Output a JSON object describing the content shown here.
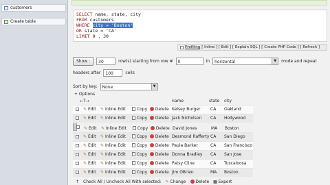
{
  "sidebar": {
    "items": [
      {
        "label": "customers",
        "icon": "table-icon"
      },
      {
        "label": "Create table",
        "icon": "add-table-icon"
      }
    ]
  },
  "sql": {
    "select_kw": "SELECT",
    "select_cols": " name, state, city",
    "from_kw": "FROM",
    "from_table": " customers",
    "where_kw": "WHERE",
    "where_sel": "city = 'Boston'",
    "or_kw": "OR",
    "or_rest": " state = 'CA'",
    "limit_kw": "LIMIT",
    "limit_rest": " 0 , 30"
  },
  "sqlbar": {
    "profiling": "Profiling",
    "links": "[ Inline ] [ Edit ] [ Explain SQL ] [ Create PHP Code ] [ Refresh ]"
  },
  "nav": {
    "show_label": "Show :",
    "rows_value": "30",
    "rows_text": "row(s) starting from row #",
    "start_value": "0",
    "in_text": "in",
    "mode_value": "horizontal",
    "mode_text": "mode and repeat",
    "headers_text": "headers after",
    "headers_value": "100",
    "cells_text": "cells"
  },
  "sort": {
    "label": "Sort by key:",
    "value": "None"
  },
  "options_label": "+ Options",
  "table": {
    "headers": {
      "arrows": "←T→",
      "name": "name",
      "state": "state",
      "city": "city"
    },
    "actions": {
      "edit": "Edit",
      "inline": "Inline Edit",
      "copy": "Copy",
      "delete": "Delete"
    },
    "rows": [
      {
        "name": "Kelsey Burger",
        "state": "CA",
        "city": "Oakland"
      },
      {
        "name": "Jack Nicholson",
        "state": "CA",
        "city": "Hollywood"
      },
      {
        "name": "David Jones",
        "state": "MA",
        "city": "Boston"
      },
      {
        "name": "Desmond Rafferty",
        "state": "CA",
        "city": "San Diego"
      },
      {
        "name": "Paula Barker",
        "state": "CA",
        "city": "San Francisco"
      },
      {
        "name": "Donna Bradley",
        "state": "CA",
        "city": "San Jose"
      },
      {
        "name": "Patsy Cline",
        "state": "CA",
        "city": "Tuscaloosa"
      },
      {
        "name": "Jim OBrien",
        "state": "MA",
        "city": "Boston"
      }
    ]
  },
  "bottom": {
    "check_all": "Check All / Uncheck All With selected:",
    "change": "Change",
    "delete": "Delete",
    "export": "Export"
  }
}
